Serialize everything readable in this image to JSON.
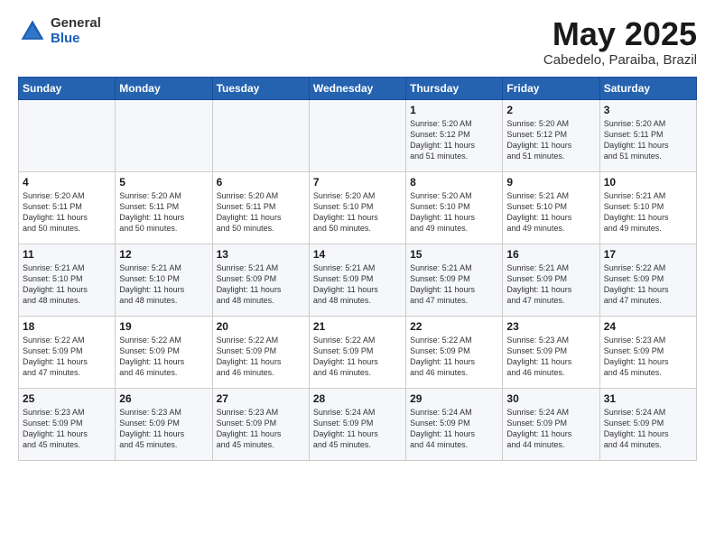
{
  "header": {
    "logo_general": "General",
    "logo_blue": "Blue",
    "calendar_title": "May 2025",
    "subtitle": "Cabedelo, Paraiba, Brazil"
  },
  "days_of_week": [
    "Sunday",
    "Monday",
    "Tuesday",
    "Wednesday",
    "Thursday",
    "Friday",
    "Saturday"
  ],
  "weeks": [
    [
      {
        "num": "",
        "info": ""
      },
      {
        "num": "",
        "info": ""
      },
      {
        "num": "",
        "info": ""
      },
      {
        "num": "",
        "info": ""
      },
      {
        "num": "1",
        "info": "Sunrise: 5:20 AM\nSunset: 5:12 PM\nDaylight: 11 hours\nand 51 minutes."
      },
      {
        "num": "2",
        "info": "Sunrise: 5:20 AM\nSunset: 5:12 PM\nDaylight: 11 hours\nand 51 minutes."
      },
      {
        "num": "3",
        "info": "Sunrise: 5:20 AM\nSunset: 5:11 PM\nDaylight: 11 hours\nand 51 minutes."
      }
    ],
    [
      {
        "num": "4",
        "info": "Sunrise: 5:20 AM\nSunset: 5:11 PM\nDaylight: 11 hours\nand 50 minutes."
      },
      {
        "num": "5",
        "info": "Sunrise: 5:20 AM\nSunset: 5:11 PM\nDaylight: 11 hours\nand 50 minutes."
      },
      {
        "num": "6",
        "info": "Sunrise: 5:20 AM\nSunset: 5:11 PM\nDaylight: 11 hours\nand 50 minutes."
      },
      {
        "num": "7",
        "info": "Sunrise: 5:20 AM\nSunset: 5:10 PM\nDaylight: 11 hours\nand 50 minutes."
      },
      {
        "num": "8",
        "info": "Sunrise: 5:20 AM\nSunset: 5:10 PM\nDaylight: 11 hours\nand 49 minutes."
      },
      {
        "num": "9",
        "info": "Sunrise: 5:21 AM\nSunset: 5:10 PM\nDaylight: 11 hours\nand 49 minutes."
      },
      {
        "num": "10",
        "info": "Sunrise: 5:21 AM\nSunset: 5:10 PM\nDaylight: 11 hours\nand 49 minutes."
      }
    ],
    [
      {
        "num": "11",
        "info": "Sunrise: 5:21 AM\nSunset: 5:10 PM\nDaylight: 11 hours\nand 48 minutes."
      },
      {
        "num": "12",
        "info": "Sunrise: 5:21 AM\nSunset: 5:10 PM\nDaylight: 11 hours\nand 48 minutes."
      },
      {
        "num": "13",
        "info": "Sunrise: 5:21 AM\nSunset: 5:09 PM\nDaylight: 11 hours\nand 48 minutes."
      },
      {
        "num": "14",
        "info": "Sunrise: 5:21 AM\nSunset: 5:09 PM\nDaylight: 11 hours\nand 48 minutes."
      },
      {
        "num": "15",
        "info": "Sunrise: 5:21 AM\nSunset: 5:09 PM\nDaylight: 11 hours\nand 47 minutes."
      },
      {
        "num": "16",
        "info": "Sunrise: 5:21 AM\nSunset: 5:09 PM\nDaylight: 11 hours\nand 47 minutes."
      },
      {
        "num": "17",
        "info": "Sunrise: 5:22 AM\nSunset: 5:09 PM\nDaylight: 11 hours\nand 47 minutes."
      }
    ],
    [
      {
        "num": "18",
        "info": "Sunrise: 5:22 AM\nSunset: 5:09 PM\nDaylight: 11 hours\nand 47 minutes."
      },
      {
        "num": "19",
        "info": "Sunrise: 5:22 AM\nSunset: 5:09 PM\nDaylight: 11 hours\nand 46 minutes."
      },
      {
        "num": "20",
        "info": "Sunrise: 5:22 AM\nSunset: 5:09 PM\nDaylight: 11 hours\nand 46 minutes."
      },
      {
        "num": "21",
        "info": "Sunrise: 5:22 AM\nSunset: 5:09 PM\nDaylight: 11 hours\nand 46 minutes."
      },
      {
        "num": "22",
        "info": "Sunrise: 5:22 AM\nSunset: 5:09 PM\nDaylight: 11 hours\nand 46 minutes."
      },
      {
        "num": "23",
        "info": "Sunrise: 5:23 AM\nSunset: 5:09 PM\nDaylight: 11 hours\nand 46 minutes."
      },
      {
        "num": "24",
        "info": "Sunrise: 5:23 AM\nSunset: 5:09 PM\nDaylight: 11 hours\nand 45 minutes."
      }
    ],
    [
      {
        "num": "25",
        "info": "Sunrise: 5:23 AM\nSunset: 5:09 PM\nDaylight: 11 hours\nand 45 minutes."
      },
      {
        "num": "26",
        "info": "Sunrise: 5:23 AM\nSunset: 5:09 PM\nDaylight: 11 hours\nand 45 minutes."
      },
      {
        "num": "27",
        "info": "Sunrise: 5:23 AM\nSunset: 5:09 PM\nDaylight: 11 hours\nand 45 minutes."
      },
      {
        "num": "28",
        "info": "Sunrise: 5:24 AM\nSunset: 5:09 PM\nDaylight: 11 hours\nand 45 minutes."
      },
      {
        "num": "29",
        "info": "Sunrise: 5:24 AM\nSunset: 5:09 PM\nDaylight: 11 hours\nand 44 minutes."
      },
      {
        "num": "30",
        "info": "Sunrise: 5:24 AM\nSunset: 5:09 PM\nDaylight: 11 hours\nand 44 minutes."
      },
      {
        "num": "31",
        "info": "Sunrise: 5:24 AM\nSunset: 5:09 PM\nDaylight: 11 hours\nand 44 minutes."
      }
    ]
  ]
}
